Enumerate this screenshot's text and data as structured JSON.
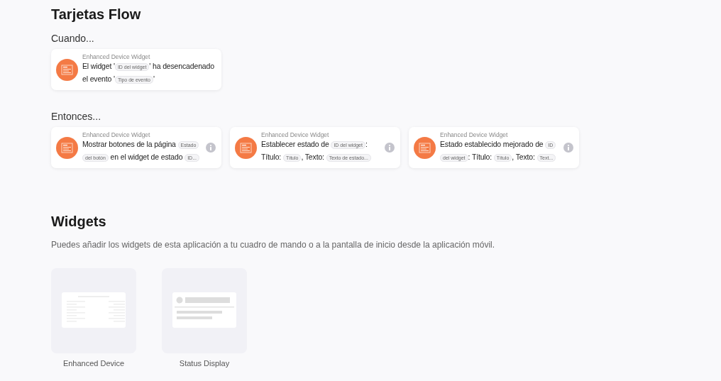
{
  "flow_cards": {
    "title": "Tarjetas Flow",
    "when": {
      "heading": "Cuando...",
      "cards": [
        {
          "app": "Enhanced Device Widget",
          "info": false,
          "parts": [
            {
              "kind": "text",
              "text": "El widget '"
            },
            {
              "kind": "token",
              "text": "ID del widget"
            },
            {
              "kind": "text",
              "text": "' ha desencadenado el evento '"
            },
            {
              "kind": "token",
              "text": "Tipo de evento"
            },
            {
              "kind": "text",
              "text": "'"
            }
          ]
        }
      ]
    },
    "then": {
      "heading": "Entonces...",
      "cards": [
        {
          "app": "Enhanced Device Widget",
          "info": true,
          "parts": [
            {
              "kind": "text",
              "text": "Mostrar botones de la página "
            },
            {
              "kind": "token",
              "text": "Estado del botón"
            },
            {
              "kind": "text",
              "text": " en el widget de estado "
            },
            {
              "kind": "token",
              "text": "ID..."
            }
          ]
        },
        {
          "app": "Enhanced Device Widget",
          "info": true,
          "parts": [
            {
              "kind": "text",
              "text": "Establecer estado de "
            },
            {
              "kind": "token",
              "text": "ID del widget"
            },
            {
              "kind": "text",
              "text": ": Título: "
            },
            {
              "kind": "token",
              "text": "Título"
            },
            {
              "kind": "text",
              "text": ", Texto: "
            },
            {
              "kind": "token",
              "text": "Texto de estado..."
            }
          ]
        },
        {
          "app": "Enhanced Device Widget",
          "info": true,
          "parts": [
            {
              "kind": "text",
              "text": "Estado establecido mejorado de "
            },
            {
              "kind": "token",
              "text": "ID del widget"
            },
            {
              "kind": "text",
              "text": ": Título: "
            },
            {
              "kind": "token",
              "text": "Título"
            },
            {
              "kind": "text",
              "text": ", Texto: "
            },
            {
              "kind": "token",
              "text": "Text..."
            }
          ]
        }
      ]
    }
  },
  "widgets": {
    "title": "Widgets",
    "description": "Puedes añadir los widgets de esta aplicación a tu cuadro de mando o a la pantalla de inicio desde la aplicación móvil.",
    "items": [
      {
        "kind": "device",
        "label": "Enhanced Device"
      },
      {
        "kind": "status",
        "label": "Status Display"
      }
    ]
  }
}
